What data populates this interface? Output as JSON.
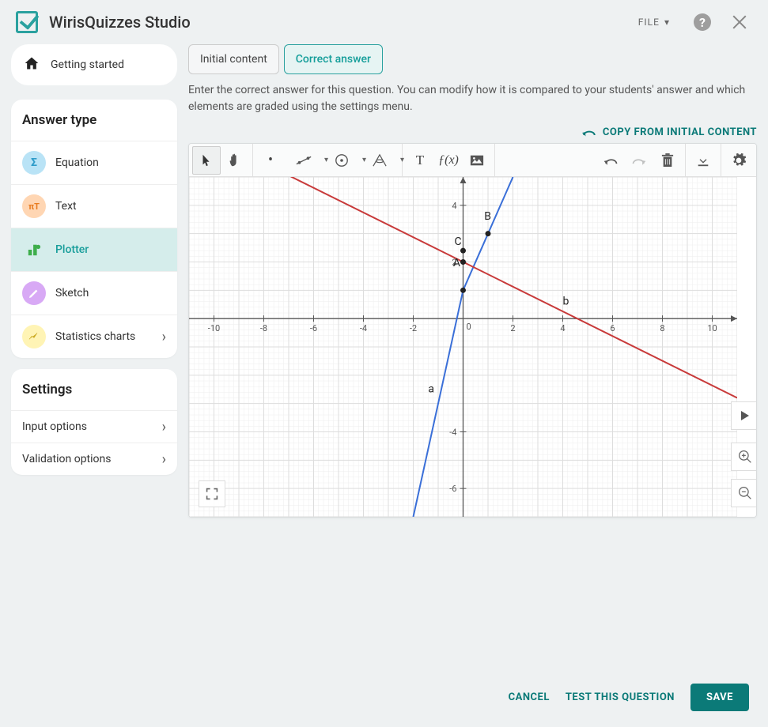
{
  "header": {
    "title": "WirisQuizzes Studio",
    "file_menu": "FILE"
  },
  "sidebar": {
    "getting_started": "Getting started",
    "answer_type_header": "Answer type",
    "items": [
      {
        "label": "Equation"
      },
      {
        "label": "Text"
      },
      {
        "label": "Plotter"
      },
      {
        "label": "Sketch"
      },
      {
        "label": "Statistics charts"
      }
    ],
    "settings_header": "Settings",
    "settings": [
      {
        "label": "Input options"
      },
      {
        "label": "Validation options"
      }
    ]
  },
  "content": {
    "tabs": {
      "initial": "Initial content",
      "correct": "Correct answer"
    },
    "instructions": "Enter the correct answer for this question. You can modify how it is compared to your students' answer and which elements are graded using the settings menu.",
    "copy_label": "COPY FROM INITIAL CONTENT",
    "fx_label": "ƒ(x)"
  },
  "chart_data": {
    "type": "line",
    "xlim": [
      -11,
      11
    ],
    "ylim": [
      -7,
      5
    ],
    "xticks": [
      -10,
      -8,
      -6,
      -4,
      -2,
      0,
      2,
      4,
      6,
      8,
      10
    ],
    "yticks": [
      -6,
      -4,
      2,
      4
    ],
    "series": [
      {
        "name": "a",
        "color": "#3a6fd8",
        "points": [
          [
            -2,
            -7
          ],
          [
            0,
            1
          ],
          [
            1,
            3
          ],
          [
            2,
            5
          ]
        ],
        "label_pos": [
          -1.4,
          -2.6
        ]
      },
      {
        "name": "b",
        "color": "#c83a3a",
        "points": [
          [
            -11,
            6.8
          ],
          [
            0,
            2
          ],
          [
            11,
            -2.8
          ]
        ],
        "label_pos": [
          4.0,
          0.5
        ]
      }
    ],
    "labeled_points": [
      {
        "name": "A",
        "x": 0,
        "y": 2,
        "label_offset": [
          -0.4,
          -0.15
        ]
      },
      {
        "name": "B",
        "x": 1,
        "y": 3,
        "label_offset": [
          -0.15,
          0.5
        ]
      },
      {
        "name": "C",
        "x": 0,
        "y": 2.4,
        "label_offset": [
          -0.35,
          0.2
        ]
      },
      {
        "name": "",
        "x": 0,
        "y": 1,
        "label_offset": [
          0,
          0
        ]
      }
    ]
  },
  "footer": {
    "cancel": "CANCEL",
    "test": "TEST THIS QUESTION",
    "save": "SAVE"
  }
}
